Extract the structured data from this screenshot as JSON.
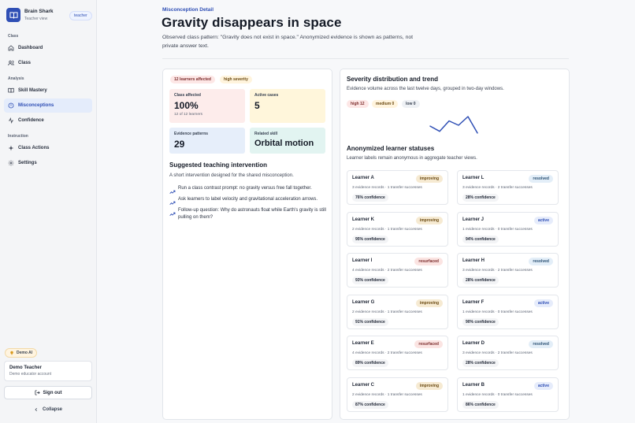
{
  "brand": {
    "name": "Brain Shark",
    "subtitle": "Teacher view",
    "role_badge": "teacher"
  },
  "sidebar": {
    "sections": [
      {
        "label": "Class",
        "items": [
          {
            "label": "Dashboard",
            "icon": "home-icon"
          },
          {
            "label": "Class",
            "icon": "users-icon"
          }
        ]
      },
      {
        "label": "Analysis",
        "items": [
          {
            "label": "Skill Mastery",
            "icon": "book-icon"
          },
          {
            "label": "Misconceptions",
            "icon": "alert-circle-icon",
            "active": true
          },
          {
            "label": "Confidence",
            "icon": "activity-icon"
          }
        ]
      },
      {
        "label": "Instruction",
        "items": [
          {
            "label": "Class Actions",
            "icon": "sparkle-icon"
          },
          {
            "label": "Settings",
            "icon": "gear-icon"
          }
        ]
      }
    ],
    "demo_badge": "Demo AI",
    "account": {
      "name": "Demo Teacher",
      "subtitle": "Demo educator account"
    },
    "signout_label": "Sign out",
    "collapse_label": "Collapse"
  },
  "header": {
    "eyebrow": "Misconception Detail",
    "title": "Gravity disappears in space",
    "description": "Observed class pattern: \"Gravity does not exist in space.\" Anonymized evidence is shown as patterns, not private answer text."
  },
  "left_panel": {
    "chips": {
      "affected": "12 learners affected",
      "severity": "high severity"
    },
    "stats": {
      "class_affected": {
        "label": "Class affected",
        "value": "100%",
        "sub": "12 of 12 learners"
      },
      "active_cases": {
        "label": "Active cases",
        "value": "5"
      },
      "evidence_patterns": {
        "label": "Evidence patterns",
        "value": "29"
      },
      "related_skill": {
        "label": "Related skill",
        "value": "Orbital motion"
      }
    },
    "intervention": {
      "title": "Suggested teaching intervention",
      "description": "A short intervention designed for the shared misconception.",
      "steps": [
        "Run a class contrast prompt: no gravity versus free fall together.",
        "Ask learners to label velocity and gravitational acceleration arrows.",
        "Follow-up question: Why do astronauts float while Earth's gravity is still pulling on them?"
      ]
    }
  },
  "right_panel": {
    "severity": {
      "title": "Severity distribution and trend",
      "description": "Evidence volume across the last twelve days, grouped in two-day windows.",
      "chips": {
        "high": "high 12",
        "medium": "medium 0",
        "low": "low 0"
      },
      "trend": [
        0.45,
        0.15,
        0.75,
        0.5,
        1.0,
        0.05
      ]
    },
    "learners": {
      "title": "Anonymized learner statuses",
      "description": "Learner labels remain anonymous in aggregate teacher views.",
      "items": [
        {
          "name": "Learner A",
          "status": "improving",
          "meta": "3 evidence records · 1 transfer successes",
          "confidence": "76% confidence"
        },
        {
          "name": "Learner L",
          "status": "resolved",
          "meta": "3 evidence records · 2 transfer successes",
          "confidence": "28% confidence"
        },
        {
          "name": "Learner K",
          "status": "improving",
          "meta": "2 evidence records · 1 transfer successes",
          "confidence": "95% confidence"
        },
        {
          "name": "Learner J",
          "status": "active",
          "meta": "1 evidence records · 0 transfer successes",
          "confidence": "94% confidence"
        },
        {
          "name": "Learner I",
          "status": "resurfaced",
          "meta": "4 evidence records · 2 transfer successes",
          "confidence": "93% confidence"
        },
        {
          "name": "Learner H",
          "status": "resolved",
          "meta": "3 evidence records · 2 transfer successes",
          "confidence": "28% confidence"
        },
        {
          "name": "Learner G",
          "status": "improving",
          "meta": "2 evidence records · 1 transfer successes",
          "confidence": "91% confidence"
        },
        {
          "name": "Learner F",
          "status": "active",
          "meta": "1 evidence records · 0 transfer successes",
          "confidence": "90% confidence"
        },
        {
          "name": "Learner E",
          "status": "resurfaced",
          "meta": "4 evidence records · 2 transfer successes",
          "confidence": "89% confidence"
        },
        {
          "name": "Learner D",
          "status": "resolved",
          "meta": "3 evidence records · 2 transfer successes",
          "confidence": "28% confidence"
        },
        {
          "name": "Learner C",
          "status": "improving",
          "meta": "2 evidence records · 1 transfer successes",
          "confidence": "87% confidence"
        },
        {
          "name": "Learner B",
          "status": "active",
          "meta": "1 evidence records · 0 transfer successes",
          "confidence": "86% confidence"
        }
      ]
    }
  },
  "colors": {
    "accent": "#2f4fb5",
    "improving": "#f6ead2",
    "resolved": "#e3eef8",
    "active": "#e6ecfb",
    "resurfaced": "#fbe4e2"
  }
}
